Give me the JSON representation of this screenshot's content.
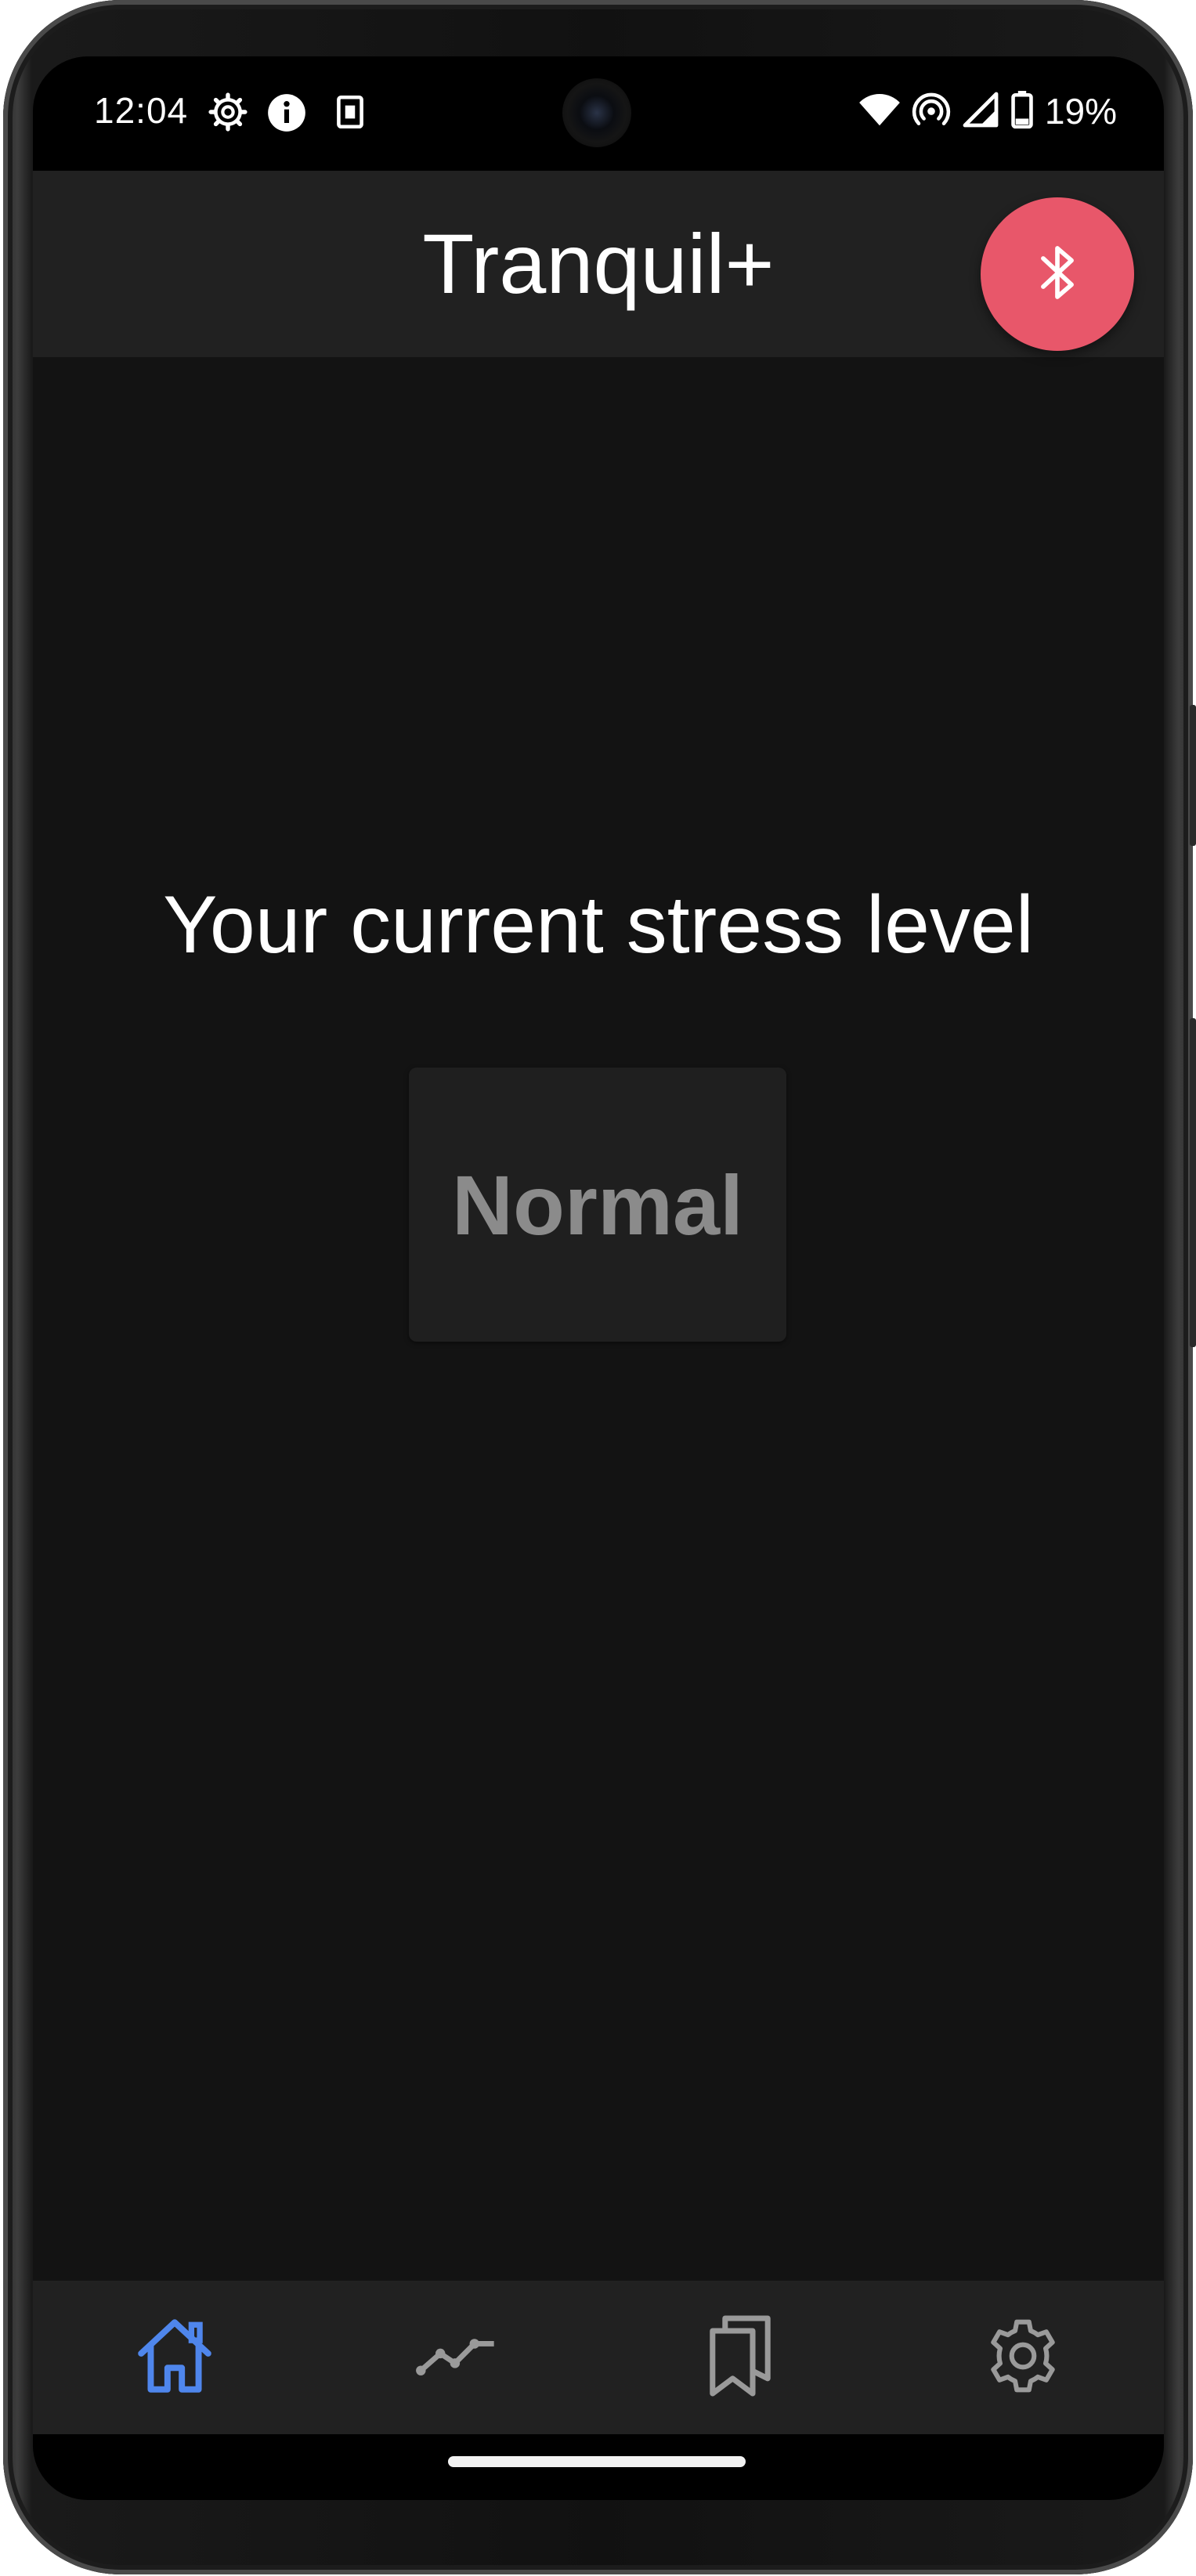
{
  "status_bar": {
    "time": "12:04",
    "battery": "19%",
    "left_icons": [
      "settings-gear-icon",
      "info-icon",
      "sim-card-icon"
    ],
    "right_icons": [
      "wifi-icon",
      "hotspot-icon",
      "cellular-signal-icon",
      "battery-icon"
    ]
  },
  "app_bar": {
    "title": "Tranquil+",
    "fab_icon": "bluetooth-icon"
  },
  "main": {
    "heading": "Your current stress level",
    "stress_value": "Normal"
  },
  "bottom_nav": {
    "items": [
      {
        "icon": "home-icon",
        "active": true
      },
      {
        "icon": "trend-line-icon",
        "active": false
      },
      {
        "icon": "bookmarks-icon",
        "active": false
      },
      {
        "icon": "settings-icon",
        "active": false
      }
    ],
    "active_color": "#4f86ec",
    "inactive_color": "#9a9a9a"
  },
  "colors": {
    "background": "#131313",
    "app_bar": "#212121",
    "fab": "#e8576a",
    "stress_text": "#8b8b8b"
  }
}
